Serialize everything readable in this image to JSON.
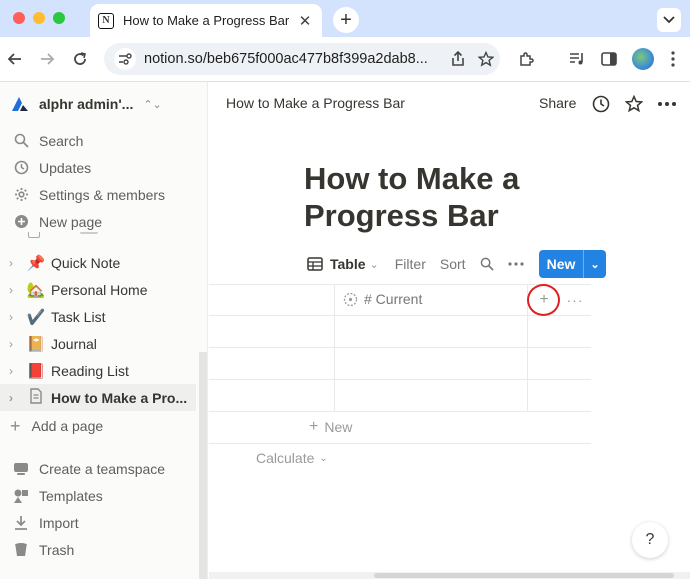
{
  "browser": {
    "tab_title": "How to Make a Progress Bar",
    "tab_favicon": "N",
    "url": "notion.so/beb675f000ac477b8f399a2dab8..."
  },
  "sidebar": {
    "workspace_name": "alphr admin'...",
    "menu": [
      {
        "label": "Search",
        "icon": "search-icon"
      },
      {
        "label": "Updates",
        "icon": "clock-icon"
      },
      {
        "label": "Settings & members",
        "icon": "gear-icon"
      },
      {
        "label": "New page",
        "icon": "plus-circle-icon"
      }
    ],
    "pages": [
      {
        "label": "Quick Note",
        "emoji": "📌"
      },
      {
        "label": "Personal Home",
        "emoji": "🏡"
      },
      {
        "label": "Task List",
        "emoji": "✔️"
      },
      {
        "label": "Journal",
        "emoji": "📔"
      },
      {
        "label": "Reading List",
        "emoji": "📕"
      },
      {
        "label": "How to Make a Pro...",
        "emoji": "page-icon",
        "active": true
      }
    ],
    "add_page": "Add a page",
    "bottom": [
      {
        "label": "Create a teamspace",
        "icon": "teamspace-icon"
      },
      {
        "label": "Templates",
        "icon": "templates-icon"
      },
      {
        "label": "Import",
        "icon": "import-icon"
      },
      {
        "label": "Trash",
        "icon": "trash-icon"
      }
    ]
  },
  "topbar": {
    "breadcrumb": "How to Make a Progress Bar",
    "share": "Share"
  },
  "page": {
    "title": "How to Make a Progress Bar"
  },
  "database": {
    "view_label": "Table",
    "filter": "Filter",
    "sort": "Sort",
    "new_button": "New",
    "column_name": "# Current",
    "new_row": "New",
    "calculate": "Calculate"
  },
  "help": "?"
}
